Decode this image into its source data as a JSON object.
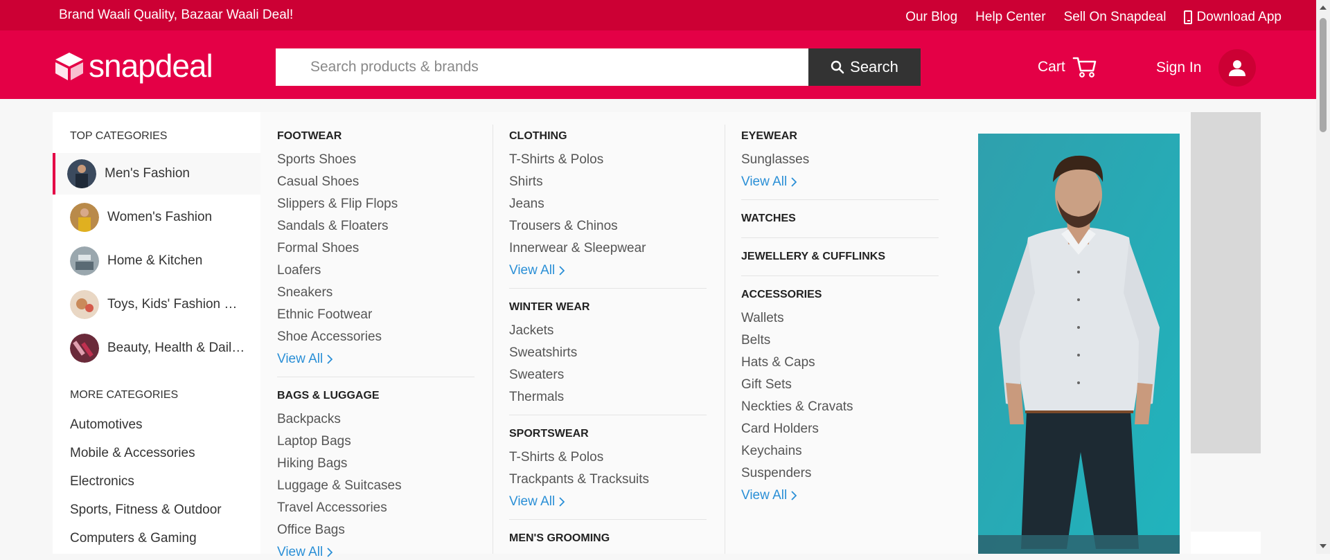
{
  "topbar": {
    "tagline": "Brand Waali Quality, Bazaar Waali Deal!",
    "links": [
      "Our Blog",
      "Help Center",
      "Sell On Snapdeal"
    ],
    "download": "Download App"
  },
  "header": {
    "logo": "snapdeal",
    "search_placeholder": "Search products & brands",
    "search_button": "Search",
    "cart": "Cart",
    "signin": "Sign In"
  },
  "sidebar": {
    "top_heading": "TOP CATEGORIES",
    "top_categories": [
      {
        "label": "Men's Fashion",
        "active": true
      },
      {
        "label": "Women's Fashion",
        "active": false
      },
      {
        "label": "Home & Kitchen",
        "active": false
      },
      {
        "label": "Toys, Kids' Fashion & m...",
        "active": false
      },
      {
        "label": "Beauty, Health & Daily ...",
        "active": false
      }
    ],
    "more_heading": "MORE CATEGORIES",
    "more_categories": [
      "Automotives",
      "Mobile & Accessories",
      "Electronics",
      "Sports, Fitness & Outdoor",
      "Computers & Gaming"
    ]
  },
  "menu": {
    "view_all": "View All",
    "col1": [
      {
        "title": "FOOTWEAR",
        "items": [
          "Sports Shoes",
          "Casual Shoes",
          "Slippers & Flip Flops",
          "Sandals & Floaters",
          "Formal Shoes",
          "Loafers",
          "Sneakers",
          "Ethnic Footwear",
          "Shoe Accessories"
        ]
      },
      {
        "title": "BAGS & LUGGAGE",
        "items": [
          "Backpacks",
          "Laptop Bags",
          "Hiking Bags",
          "Luggage & Suitcases",
          "Travel Accessories",
          "Office Bags"
        ]
      }
    ],
    "col2": [
      {
        "title": "CLOTHING",
        "items": [
          "T-Shirts & Polos",
          "Shirts",
          "Jeans",
          "Trousers & Chinos",
          "Innerwear & Sleepwear"
        ]
      },
      {
        "title": "WINTER WEAR",
        "items": [
          "Jackets",
          "Sweatshirts",
          "Sweaters",
          "Thermals"
        ]
      },
      {
        "title": "SPORTSWEAR",
        "items": [
          "T-Shirts & Polos",
          "Trackpants & Tracksuits"
        ]
      },
      {
        "title": "MEN'S GROOMING",
        "items": []
      }
    ],
    "col3": [
      {
        "title": "EYEWEAR",
        "items": [
          "Sunglasses"
        ]
      },
      {
        "title": "WATCHES",
        "items": []
      },
      {
        "title": "JEWELLERY & CUFFLINKS",
        "items": []
      },
      {
        "title": "ACCESSORIES",
        "items": [
          "Wallets",
          "Belts",
          "Hats & Caps",
          "Gift Sets",
          "Neckties & Cravats",
          "Card Holders",
          "Keychains",
          "Suspenders"
        ]
      }
    ]
  },
  "colors": {
    "brand_red": "#e40046",
    "topbar_red": "#cc0034",
    "link_blue": "#2a8fd6",
    "search_button": "#333333"
  }
}
